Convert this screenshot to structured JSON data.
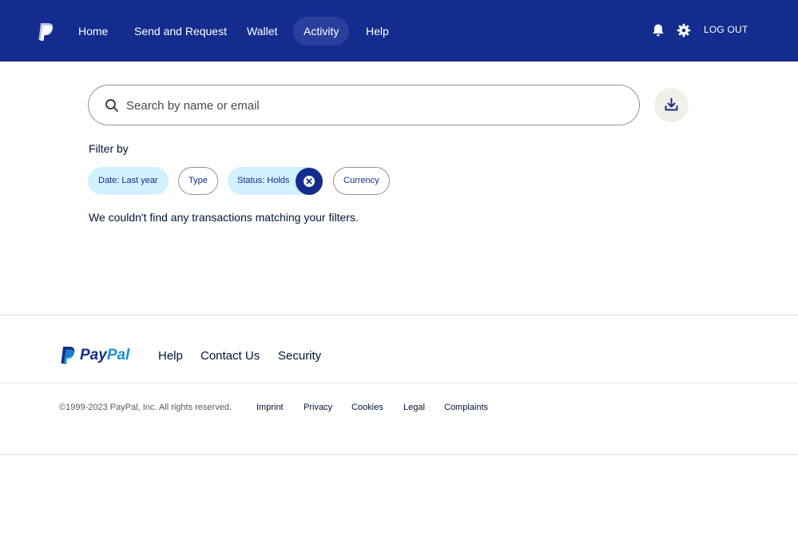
{
  "header": {
    "nav": [
      {
        "label": "Home"
      },
      {
        "label": "Send and Request"
      },
      {
        "label": "Wallet"
      },
      {
        "label": "Activity",
        "active": true
      },
      {
        "label": "Help"
      }
    ],
    "logout_label": "LOG OUT",
    "icons": [
      "paypal-logo-icon",
      "bell-icon",
      "gear-icon"
    ],
    "colors": {
      "background": "#142c8e",
      "active_tab": "#2a3f9b"
    }
  },
  "search": {
    "placeholder": "Search by name or email",
    "value": "",
    "icons": [
      "search-icon",
      "download-icon"
    ]
  },
  "filters": {
    "label": "Filter by",
    "chips": [
      {
        "label": "Date: Last year",
        "selected": true
      },
      {
        "label": "Type",
        "selected": false
      },
      {
        "label": "Status: Holds",
        "selected": true,
        "clearable": true
      },
      {
        "label": "Currency",
        "selected": false
      }
    ],
    "colors": {
      "selected_bg": "#d1f1ff",
      "text": "#142c8e"
    }
  },
  "results": {
    "empty_message": "We couldn't find any transactions matching your filters."
  },
  "footer": {
    "brand": {
      "pay": "Pay",
      "pal": "Pal"
    },
    "links": [
      {
        "label": "Help"
      },
      {
        "label": "Contact Us"
      },
      {
        "label": "Security"
      }
    ],
    "copyright": "©1999-2023 PayPal, Inc. All rights reserved.",
    "legal_links": [
      {
        "label": "Imprint"
      },
      {
        "label": "Privacy"
      },
      {
        "label": "Cookies"
      },
      {
        "label": "Legal"
      },
      {
        "label": "Complaints"
      }
    ]
  }
}
